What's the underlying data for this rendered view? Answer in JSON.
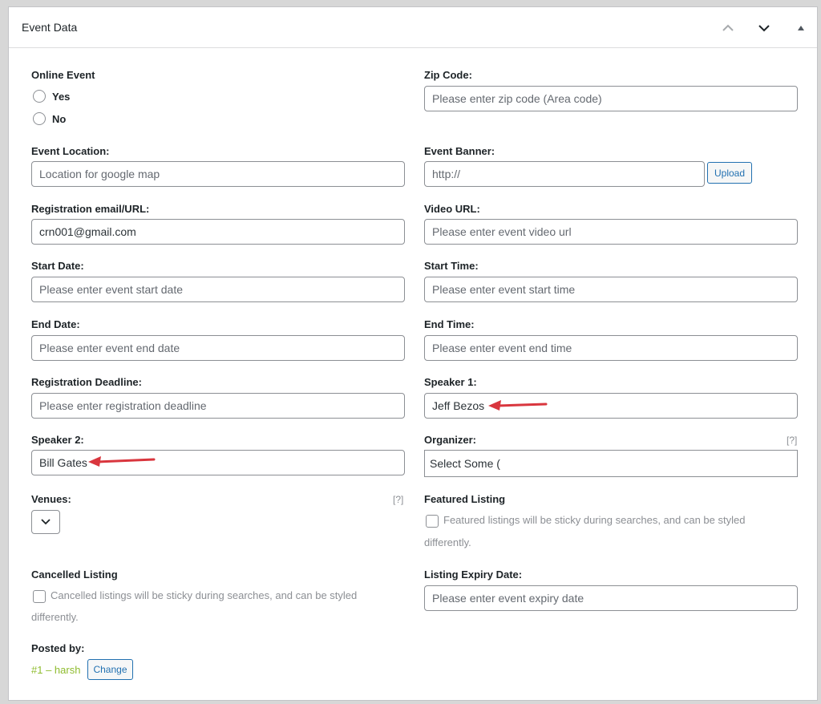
{
  "panel": {
    "title": "Event Data",
    "controls": [
      "chevron-up-icon",
      "chevron-down-icon",
      "triangle-up-icon"
    ]
  },
  "online_event": {
    "label": "Online Event",
    "options": [
      "Yes",
      "No"
    ]
  },
  "zip_code": {
    "label": "Zip Code:",
    "placeholder": "Please enter zip code (Area code)"
  },
  "event_location": {
    "label": "Event Location:",
    "placeholder": "Location for google map"
  },
  "event_banner": {
    "label": "Event Banner:",
    "placeholder": "http://",
    "upload_label": "Upload"
  },
  "registration": {
    "label": "Registration email/URL:",
    "value": "crn001@gmail.com"
  },
  "video_url": {
    "label": "Video URL:",
    "placeholder": "Please enter event video url"
  },
  "start_date": {
    "label": "Start Date:",
    "placeholder": "Please enter event start date"
  },
  "start_time": {
    "label": "Start Time:",
    "placeholder": "Please enter event start time"
  },
  "end_date": {
    "label": "End Date:",
    "placeholder": "Please enter event end date"
  },
  "end_time": {
    "label": "End Time:",
    "placeholder": "Please enter event end time"
  },
  "registration_deadline": {
    "label": "Registration Deadline:",
    "placeholder": "Please enter registration deadline"
  },
  "speaker1": {
    "label": "Speaker 1:",
    "value": "Jeff Bezos"
  },
  "speaker2": {
    "label": "Speaker 2:",
    "value": "Bill Gates"
  },
  "organizer": {
    "label": "Organizer:",
    "help": "[?]",
    "value": "Select Some ("
  },
  "venues": {
    "label": "Venues:",
    "help": "[?]"
  },
  "featured": {
    "label": "Featured Listing",
    "line1": "Featured listings will be sticky during searches, and can be styled",
    "line2": "differently."
  },
  "cancelled": {
    "label": "Cancelled Listing",
    "line1": "Cancelled listings will be sticky during searches, and can be styled",
    "line2": "differently."
  },
  "expiry": {
    "label": "Listing Expiry Date:",
    "placeholder": "Please enter event expiry date"
  },
  "posted_by": {
    "label": "Posted by:",
    "user": "#1 – harsh",
    "change_label": "Change"
  },
  "colors": {
    "annotation_arrow": "#d9363e",
    "user_link": "#8fbc2f",
    "button_blue": "#2271b1"
  }
}
